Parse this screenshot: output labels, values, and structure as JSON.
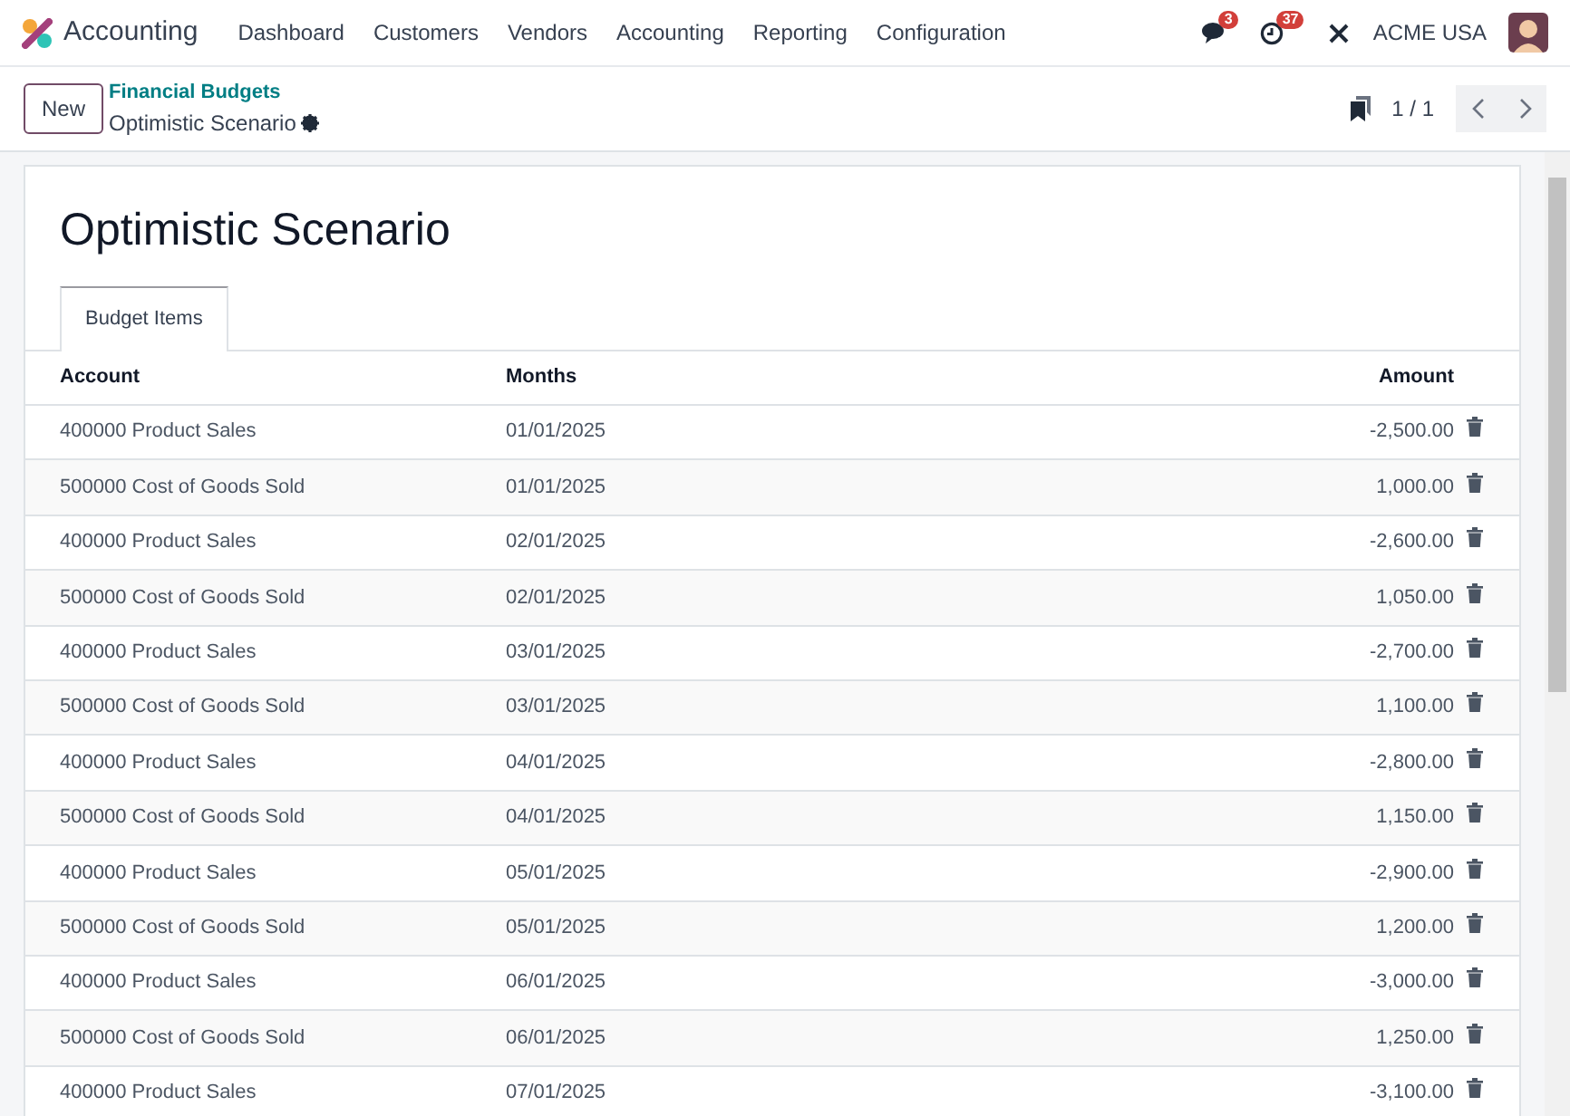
{
  "app": {
    "name": "Accounting",
    "menu": [
      "Dashboard",
      "Customers",
      "Vendors",
      "Accounting",
      "Reporting",
      "Configuration"
    ]
  },
  "systray": {
    "messages": "3",
    "activities": "37",
    "company": "ACME USA"
  },
  "control_panel": {
    "new_button": "New",
    "breadcrumb": "Financial Budgets",
    "record": "Optimistic Scenario",
    "pager": "1 / 1"
  },
  "form": {
    "title": "Optimistic Scenario",
    "tabs": [
      {
        "label": "Budget Items",
        "selected": true
      }
    ],
    "table": {
      "columns": [
        "Account",
        "Months",
        "Amount"
      ],
      "rows": [
        [
          "400000 Product Sales",
          "01/01/2025",
          "-2,500.00"
        ],
        [
          "500000 Cost of Goods Sold",
          "01/01/2025",
          "1,000.00"
        ],
        [
          "400000 Product Sales",
          "02/01/2025",
          "-2,600.00"
        ],
        [
          "500000 Cost of Goods Sold",
          "02/01/2025",
          "1,050.00"
        ],
        [
          "400000 Product Sales",
          "03/01/2025",
          "-2,700.00"
        ],
        [
          "500000 Cost of Goods Sold",
          "03/01/2025",
          "1,100.00"
        ],
        [
          "400000 Product Sales",
          "04/01/2025",
          "-2,800.00"
        ],
        [
          "500000 Cost of Goods Sold",
          "04/01/2025",
          "1,150.00"
        ],
        [
          "400000 Product Sales",
          "05/01/2025",
          "-2,900.00"
        ],
        [
          "500000 Cost of Goods Sold",
          "05/01/2025",
          "1,200.00"
        ],
        [
          "400000 Product Sales",
          "06/01/2025",
          "-3,000.00"
        ],
        [
          "500000 Cost of Goods Sold",
          "06/01/2025",
          "1,250.00"
        ],
        [
          "400000 Product Sales",
          "07/01/2025",
          "-3,100.00"
        ]
      ]
    }
  }
}
